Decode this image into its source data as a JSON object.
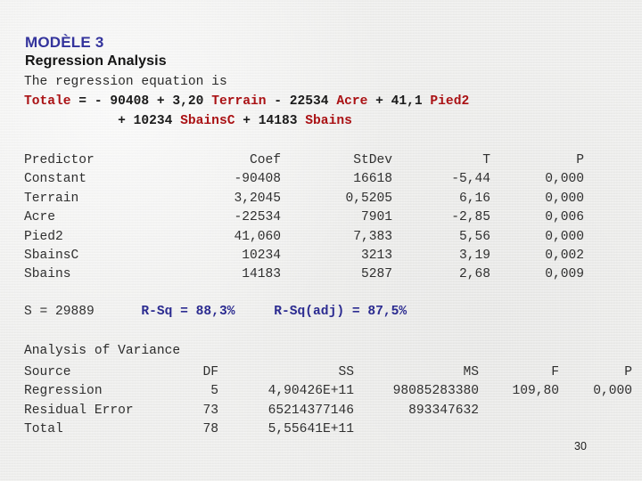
{
  "slide": {
    "model_title": "MODÈLE 3",
    "section_title": "Regression Analysis",
    "page_number": "30",
    "colors": {
      "background": "#ededeb",
      "title_blue": "#33339c",
      "equation_red": "#aa1114",
      "rsq_blue": "#2b2b90",
      "body_text": "#2f2f2f"
    }
  },
  "equation": {
    "intro": "The regression equation is",
    "line1": [
      {
        "text": "Totale",
        "color": "red"
      },
      {
        "text": " = - 90408 + 3,20 ",
        "color": "black"
      },
      {
        "text": "Terrain",
        "color": "red"
      },
      {
        "text": " - 22534 ",
        "color": "black"
      },
      {
        "text": "Acre",
        "color": "red"
      },
      {
        "text": " + 41,1 ",
        "color": "black"
      },
      {
        "text": "Pied2",
        "color": "red"
      }
    ],
    "line2": [
      {
        "text": "            + 10234 ",
        "color": "black"
      },
      {
        "text": "SbainsC",
        "color": "red"
      },
      {
        "text": " + 14183 ",
        "color": "black"
      },
      {
        "text": "Sbains",
        "color": "red"
      }
    ]
  },
  "predictor_table": {
    "headers": [
      "Predictor",
      "Coef",
      "StDev",
      "T",
      "P"
    ],
    "rows": [
      {
        "predictor": "Constant",
        "coef": "-90408",
        "stdev": "16618",
        "t": "-5,44",
        "p": "0,000"
      },
      {
        "predictor": "Terrain",
        "coef": "3,2045",
        "stdev": "0,5205",
        "t": "6,16",
        "p": "0,000"
      },
      {
        "predictor": "Acre",
        "coef": "-22534",
        "stdev": "7901",
        "t": "-2,85",
        "p": "0,006"
      },
      {
        "predictor": "Pied2",
        "coef": "41,060",
        "stdev": "7,383",
        "t": "5,56",
        "p": "0,000"
      },
      {
        "predictor": "SbainsC",
        "coef": "10234",
        "stdev": "3213",
        "t": "3,19",
        "p": "0,002"
      },
      {
        "predictor": "Sbains",
        "coef": "14183",
        "stdev": "5287",
        "t": "2,68",
        "p": "0,009"
      }
    ]
  },
  "summary": {
    "s_label": "S = 29889",
    "rsq": "R-Sq = 88,3%",
    "rsq_adj": "R-Sq(adj) = 87,5%"
  },
  "anova": {
    "title": "Analysis of Variance",
    "headers": [
      "Source",
      "DF",
      "SS",
      "MS",
      "F",
      "P"
    ],
    "rows": [
      {
        "source": "Regression",
        "df": "5",
        "ss": "4,90426E+11",
        "ms": "98085283380",
        "f": "109,80",
        "p": "0,000"
      },
      {
        "source": "Residual Error",
        "df": "73",
        "ss": "65214377146",
        "ms": "893347632",
        "f": "",
        "p": ""
      },
      {
        "source": "Total",
        "df": "78",
        "ss": "5,55641E+11",
        "ms": "",
        "f": "",
        "p": ""
      }
    ]
  },
  "chart_data": {
    "type": "table",
    "title": "Regression Analysis — MODÈLE 3",
    "response": "Totale",
    "predictors": [
      "Terrain",
      "Acre",
      "Pied2",
      "SbainsC",
      "Sbains"
    ],
    "equation": "Totale = - 90408 + 3,20 Terrain - 22534 Acre + 41,1 Pied2 + 10234 SbainsC + 14183 Sbains",
    "coefficients": {
      "Constant": -90408,
      "Terrain": 3.2045,
      "Acre": -22534,
      "Pied2": 41.06,
      "SbainsC": 10234,
      "Sbains": 14183
    },
    "standard_errors": {
      "Constant": 16618,
      "Terrain": 0.5205,
      "Acre": 7901,
      "Pied2": 7.383,
      "SbainsC": 3213,
      "Sbains": 5287
    },
    "t_values": {
      "Constant": -5.44,
      "Terrain": 6.16,
      "Acre": -2.85,
      "Pied2": 5.56,
      "SbainsC": 3.19,
      "Sbains": 2.68
    },
    "p_values": {
      "Constant": 0.0,
      "Terrain": 0.0,
      "Acre": 0.006,
      "Pied2": 0.0,
      "SbainsC": 0.002,
      "Sbains": 0.009
    },
    "model_fit": {
      "S": 29889,
      "R_Sq_percent": 88.3,
      "R_Sq_adj_percent": 87.5
    },
    "anova": {
      "Regression": {
        "DF": 5,
        "SS": 490426000000.0,
        "MS": 98085283380,
        "F": 109.8,
        "P": 0.0
      },
      "Residual Error": {
        "DF": 73,
        "SS": 65214377146,
        "MS": 893347632
      },
      "Total": {
        "DF": 78,
        "SS": 555641000000.0
      }
    }
  }
}
